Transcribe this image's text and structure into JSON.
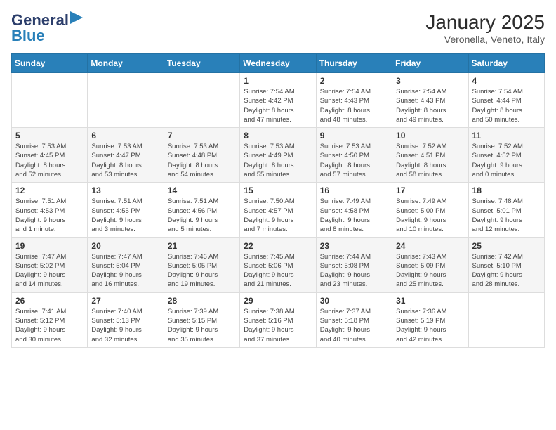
{
  "header": {
    "logo": {
      "general": "General",
      "blue": "Blue"
    },
    "title": "January 2025",
    "subtitle": "Veronella, Veneto, Italy"
  },
  "weekdays": [
    "Sunday",
    "Monday",
    "Tuesday",
    "Wednesday",
    "Thursday",
    "Friday",
    "Saturday"
  ],
  "weeks": [
    [
      {
        "day": "",
        "info": ""
      },
      {
        "day": "",
        "info": ""
      },
      {
        "day": "",
        "info": ""
      },
      {
        "day": "1",
        "info": "Sunrise: 7:54 AM\nSunset: 4:42 PM\nDaylight: 8 hours\nand 47 minutes."
      },
      {
        "day": "2",
        "info": "Sunrise: 7:54 AM\nSunset: 4:43 PM\nDaylight: 8 hours\nand 48 minutes."
      },
      {
        "day": "3",
        "info": "Sunrise: 7:54 AM\nSunset: 4:43 PM\nDaylight: 8 hours\nand 49 minutes."
      },
      {
        "day": "4",
        "info": "Sunrise: 7:54 AM\nSunset: 4:44 PM\nDaylight: 8 hours\nand 50 minutes."
      }
    ],
    [
      {
        "day": "5",
        "info": "Sunrise: 7:53 AM\nSunset: 4:45 PM\nDaylight: 8 hours\nand 52 minutes."
      },
      {
        "day": "6",
        "info": "Sunrise: 7:53 AM\nSunset: 4:47 PM\nDaylight: 8 hours\nand 53 minutes."
      },
      {
        "day": "7",
        "info": "Sunrise: 7:53 AM\nSunset: 4:48 PM\nDaylight: 8 hours\nand 54 minutes."
      },
      {
        "day": "8",
        "info": "Sunrise: 7:53 AM\nSunset: 4:49 PM\nDaylight: 8 hours\nand 55 minutes."
      },
      {
        "day": "9",
        "info": "Sunrise: 7:53 AM\nSunset: 4:50 PM\nDaylight: 8 hours\nand 57 minutes."
      },
      {
        "day": "10",
        "info": "Sunrise: 7:52 AM\nSunset: 4:51 PM\nDaylight: 8 hours\nand 58 minutes."
      },
      {
        "day": "11",
        "info": "Sunrise: 7:52 AM\nSunset: 4:52 PM\nDaylight: 9 hours\nand 0 minutes."
      }
    ],
    [
      {
        "day": "12",
        "info": "Sunrise: 7:51 AM\nSunset: 4:53 PM\nDaylight: 9 hours\nand 1 minute."
      },
      {
        "day": "13",
        "info": "Sunrise: 7:51 AM\nSunset: 4:55 PM\nDaylight: 9 hours\nand 3 minutes."
      },
      {
        "day": "14",
        "info": "Sunrise: 7:51 AM\nSunset: 4:56 PM\nDaylight: 9 hours\nand 5 minutes."
      },
      {
        "day": "15",
        "info": "Sunrise: 7:50 AM\nSunset: 4:57 PM\nDaylight: 9 hours\nand 7 minutes."
      },
      {
        "day": "16",
        "info": "Sunrise: 7:49 AM\nSunset: 4:58 PM\nDaylight: 9 hours\nand 8 minutes."
      },
      {
        "day": "17",
        "info": "Sunrise: 7:49 AM\nSunset: 5:00 PM\nDaylight: 9 hours\nand 10 minutes."
      },
      {
        "day": "18",
        "info": "Sunrise: 7:48 AM\nSunset: 5:01 PM\nDaylight: 9 hours\nand 12 minutes."
      }
    ],
    [
      {
        "day": "19",
        "info": "Sunrise: 7:47 AM\nSunset: 5:02 PM\nDaylight: 9 hours\nand 14 minutes."
      },
      {
        "day": "20",
        "info": "Sunrise: 7:47 AM\nSunset: 5:04 PM\nDaylight: 9 hours\nand 16 minutes."
      },
      {
        "day": "21",
        "info": "Sunrise: 7:46 AM\nSunset: 5:05 PM\nDaylight: 9 hours\nand 19 minutes."
      },
      {
        "day": "22",
        "info": "Sunrise: 7:45 AM\nSunset: 5:06 PM\nDaylight: 9 hours\nand 21 minutes."
      },
      {
        "day": "23",
        "info": "Sunrise: 7:44 AM\nSunset: 5:08 PM\nDaylight: 9 hours\nand 23 minutes."
      },
      {
        "day": "24",
        "info": "Sunrise: 7:43 AM\nSunset: 5:09 PM\nDaylight: 9 hours\nand 25 minutes."
      },
      {
        "day": "25",
        "info": "Sunrise: 7:42 AM\nSunset: 5:10 PM\nDaylight: 9 hours\nand 28 minutes."
      }
    ],
    [
      {
        "day": "26",
        "info": "Sunrise: 7:41 AM\nSunset: 5:12 PM\nDaylight: 9 hours\nand 30 minutes."
      },
      {
        "day": "27",
        "info": "Sunrise: 7:40 AM\nSunset: 5:13 PM\nDaylight: 9 hours\nand 32 minutes."
      },
      {
        "day": "28",
        "info": "Sunrise: 7:39 AM\nSunset: 5:15 PM\nDaylight: 9 hours\nand 35 minutes."
      },
      {
        "day": "29",
        "info": "Sunrise: 7:38 AM\nSunset: 5:16 PM\nDaylight: 9 hours\nand 37 minutes."
      },
      {
        "day": "30",
        "info": "Sunrise: 7:37 AM\nSunset: 5:18 PM\nDaylight: 9 hours\nand 40 minutes."
      },
      {
        "day": "31",
        "info": "Sunrise: 7:36 AM\nSunset: 5:19 PM\nDaylight: 9 hours\nand 42 minutes."
      },
      {
        "day": "",
        "info": ""
      }
    ]
  ]
}
